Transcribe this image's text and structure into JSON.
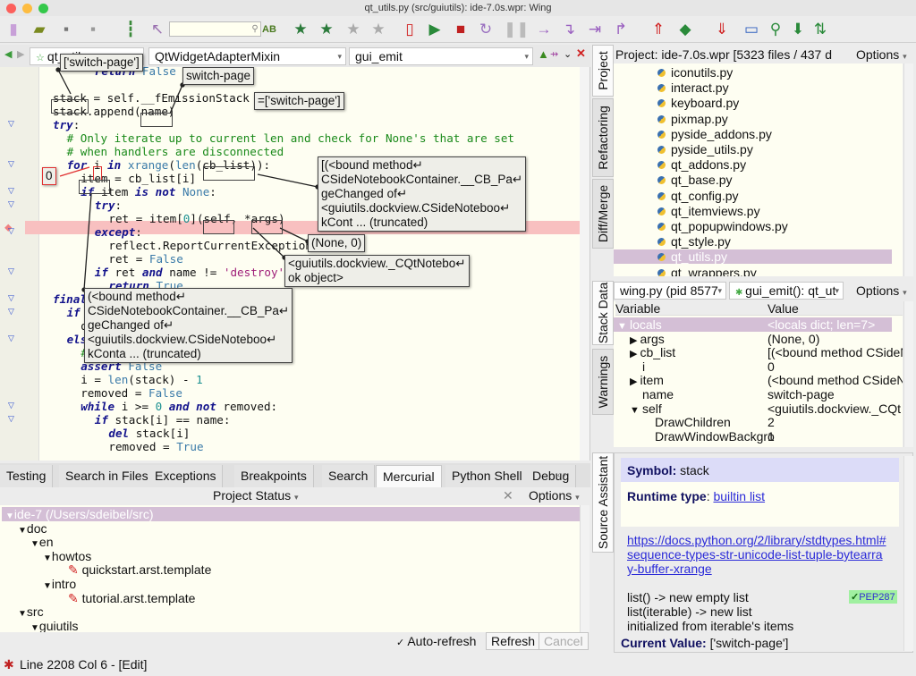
{
  "window": {
    "title": "qt_utils.py (src/guiutils): ide-7.0s.wpr: Wing"
  },
  "toolbar": {
    "icons": [
      "new-file-icon",
      "open-folder-icon",
      "save-icon",
      "save-all-icon",
      "indent-icon",
      "goto-icon",
      "search-icon",
      "spellcheck-icon",
      "bookmark-icon",
      "bookmark-goto-icon",
      "bookmark-prev-icon",
      "bookmark-next-icon",
      "debug-file-icon",
      "run-icon",
      "stop-icon",
      "restart-icon",
      "pause-icon",
      "step-into-icon",
      "step-over-icon",
      "step-out-icon",
      "step-return-icon",
      "up-stack-icon",
      "frame-icon",
      "down-stack-icon",
      "monitor-icon",
      "zoom-icon",
      "download-icon",
      "sync-icon"
    ],
    "search_value": ""
  },
  "editor": {
    "file_combo": "qt_utils",
    "class_combo": "QtWidgetAdapterMixin",
    "method_combo": "gui_emit",
    "highlight_color": "#f8c0c0",
    "lines": [
      [
        [
          3,
          "kw",
          "return"
        ],
        [
          0,
          "",
          " "
        ],
        [
          0,
          "bi",
          "False"
        ]
      ],
      [],
      [
        [
          0,
          "",
          "stack = self.__fEmissionStack"
        ]
      ],
      [
        [
          0,
          "",
          "stack.append(name)"
        ]
      ],
      [
        [
          0,
          "kw",
          "try"
        ],
        [
          0,
          "",
          ":"
        ]
      ],
      [
        [
          1,
          "cm",
          "# Only iterate up to current len and check for None's that are set"
        ]
      ],
      [
        [
          1,
          "cm",
          "# when handlers are disconnected"
        ]
      ],
      [
        [
          1,
          "kw",
          "for"
        ],
        [
          0,
          "",
          " i "
        ],
        [
          0,
          "kw",
          "in"
        ],
        [
          0,
          "",
          " "
        ],
        [
          0,
          "bi",
          "xrange"
        ],
        [
          0,
          "",
          "("
        ],
        [
          0,
          "bi",
          "len"
        ],
        [
          0,
          "",
          "(cb_list)):"
        ]
      ],
      [
        [
          2,
          "",
          "item = cb_list[i]"
        ]
      ],
      [
        [
          2,
          "kw",
          "if"
        ],
        [
          0,
          "",
          " item "
        ],
        [
          0,
          "kw",
          "is not"
        ],
        [
          0,
          "",
          " "
        ],
        [
          0,
          "bi",
          "None"
        ],
        [
          0,
          "",
          ":"
        ]
      ],
      [
        [
          3,
          "kw",
          "try"
        ],
        [
          0,
          "",
          ":"
        ]
      ],
      [
        [
          4,
          "",
          "ret = item["
        ],
        [
          0,
          "nm",
          "0"
        ],
        [
          0,
          "",
          "](self, *args)"
        ]
      ],
      [
        [
          3,
          "kw",
          "except"
        ],
        [
          0,
          "",
          ":"
        ]
      ],
      [
        [
          4,
          "",
          "reflect.ReportCurrentException()"
        ]
      ],
      [
        [
          4,
          "",
          "ret = "
        ],
        [
          0,
          "bi",
          "False"
        ]
      ],
      [
        [
          3,
          "kw",
          "if"
        ],
        [
          0,
          "",
          " ret "
        ],
        [
          0,
          "kw",
          "and"
        ],
        [
          0,
          "",
          " name != "
        ],
        [
          0,
          "st",
          "'destroy'"
        ],
        [
          0,
          "",
          ":"
        ]
      ],
      [
        [
          4,
          "kw",
          "return"
        ],
        [
          0,
          "",
          " "
        ],
        [
          0,
          "bi",
          "True"
        ]
      ],
      [
        [
          0,
          "kw",
          "finally"
        ],
        [
          0,
          "",
          ":"
        ]
      ],
      [
        [
          1,
          "kw",
          "if"
        ]
      ],
      [
        [
          2,
          "",
          "d"
        ]
      ],
      [
        [
          1,
          "kw",
          "else"
        ],
        [
          0,
          "",
          ":"
        ]
      ],
      [
        [
          2,
          "cm",
          "# recover"
        ]
      ],
      [
        [
          2,
          "kw",
          "assert"
        ],
        [
          0,
          "",
          " "
        ],
        [
          0,
          "bi",
          "False"
        ]
      ],
      [
        [
          2,
          "",
          "i = "
        ],
        [
          0,
          "bi",
          "len"
        ],
        [
          0,
          "",
          "(stack) - "
        ],
        [
          0,
          "nm",
          "1"
        ]
      ],
      [
        [
          2,
          "",
          "removed = "
        ],
        [
          0,
          "bi",
          "False"
        ]
      ],
      [
        [
          2,
          "kw",
          "while"
        ],
        [
          0,
          "",
          " i >= "
        ],
        [
          0,
          "nm",
          "0"
        ],
        [
          0,
          "",
          " "
        ],
        [
          0,
          "kw",
          "and not"
        ],
        [
          0,
          "",
          " removed:"
        ]
      ],
      [
        [
          3,
          "kw",
          "if"
        ],
        [
          0,
          "",
          " stack[i] == name:"
        ]
      ],
      [
        [
          4,
          "kw",
          "del"
        ],
        [
          0,
          "",
          " stack[i]"
        ]
      ],
      [
        [
          4,
          "",
          "removed = "
        ],
        [
          0,
          "bi",
          "True"
        ]
      ]
    ],
    "tooltips": {
      "stack_val": "['switch-page']",
      "name_val": "switch-page",
      "emission_val": "=['switch-page']",
      "cb_list_val": "[(<bound method↵\nCSideNotebookContainer.__CB_Pa↵\ngeChanged of↵\n<guiutils.dockview.CSideNoteboo↵\nkCont ... (truncated)",
      "i_val": "0",
      "args_val": "(None, 0)",
      "self_val": "<guiutils.dockview._CQtNotebo↵\nok object>",
      "item_val": "(<bound method↵\nCSideNotebookContainer.__CB_Pa↵\ngeChanged of↵\n<guiutils.dockview.CSideNoteboo↵\nkConta ... (truncated)"
    }
  },
  "bottom": {
    "tabs": [
      "Testing",
      "Search in Files",
      "Exceptions",
      "Breakpoints",
      "Search",
      "Mercurial",
      "Python Shell",
      "Debug"
    ],
    "active_tab": "Mercurial",
    "header": "Project Status",
    "options": "Options",
    "tree": [
      {
        "label": "ide-7 (/Users/sdeibel/src)",
        "depth": 0,
        "expanded": true,
        "selected": true
      },
      {
        "label": "doc",
        "depth": 1,
        "expanded": true
      },
      {
        "label": "en",
        "depth": 2,
        "expanded": true
      },
      {
        "label": "howtos",
        "depth": 3,
        "expanded": true
      },
      {
        "label": "quickstart.arst.template",
        "depth": 5,
        "modified": true
      },
      {
        "label": "intro",
        "depth": 3,
        "expanded": true
      },
      {
        "label": "tutorial.arst.template",
        "depth": 5,
        "modified": true
      },
      {
        "label": "src",
        "depth": 1,
        "expanded": true
      },
      {
        "label": "guiutils",
        "depth": 2,
        "expanded": true
      }
    ],
    "auto_refresh_label": "Auto-refresh",
    "auto_refresh_checked": true,
    "refresh": "Refresh",
    "cancel": "Cancel"
  },
  "status": {
    "text": "Line 2208 Col 6 - [Edit]"
  },
  "project": {
    "tabs": [
      "Project",
      "Refactoring",
      "Diff/Merge"
    ],
    "header": "Project: ide-7.0s.wpr [5323 files / 437 d",
    "options": "Options",
    "files": [
      "iconutils.py",
      "interact.py",
      "keyboard.py",
      "pixmap.py",
      "pyside_addons.py",
      "pyside_utils.py",
      "qt_addons.py",
      "qt_base.py",
      "qt_config.py",
      "qt_itemviews.py",
      "qt_popupwindows.py",
      "qt_style.py",
      "qt_utils.py",
      "qt_wrappers.py"
    ],
    "selected": "qt_utils.py"
  },
  "stack": {
    "tabs": [
      "Stack Data",
      "Warnings"
    ],
    "process": "wing.py (pid 8577",
    "frame": "gui_emit(): qt_ut",
    "options": "Options",
    "col_variable": "Variable",
    "col_value": "Value",
    "rows": [
      {
        "name": "locals",
        "value": "<locals dict; len=7>",
        "depth": 0,
        "toggle": "▼",
        "selected": true
      },
      {
        "name": "args",
        "value": "(None, 0)",
        "depth": 1,
        "toggle": "▶"
      },
      {
        "name": "cb_list",
        "value": "[(<bound method CSideN",
        "depth": 1,
        "toggle": "▶"
      },
      {
        "name": "i",
        "value": "0",
        "depth": 1,
        "toggle": ""
      },
      {
        "name": "item",
        "value": "(<bound method CSideN",
        "depth": 1,
        "toggle": "▶"
      },
      {
        "name": "name",
        "value": "switch-page",
        "depth": 1,
        "toggle": ""
      },
      {
        "name": "self",
        "value": "<guiutils.dockview._CQt",
        "depth": 1,
        "toggle": "▼"
      },
      {
        "name": "DrawChildren",
        "value": "2",
        "depth": 2,
        "toggle": ""
      },
      {
        "name": "DrawWindowBackgro",
        "value": "1",
        "depth": 2,
        "toggle": ""
      }
    ]
  },
  "assistant": {
    "tab": "Source Assistant",
    "symbol_label": "Symbol:",
    "symbol": "stack",
    "runtime_label": "Runtime type",
    "runtime_type": "builtin list",
    "doc_url": "https://docs.python.org/2/library/stdtypes.html#sequence-types-str-unicode-list-tuple-bytearray-buffer-xrange",
    "description": "list() -> new empty list list(iterable) -> new list initialized from iterable's items",
    "pep_badge": "PEP287",
    "current_label": "Current Value:",
    "current_value": "['switch-page']"
  }
}
